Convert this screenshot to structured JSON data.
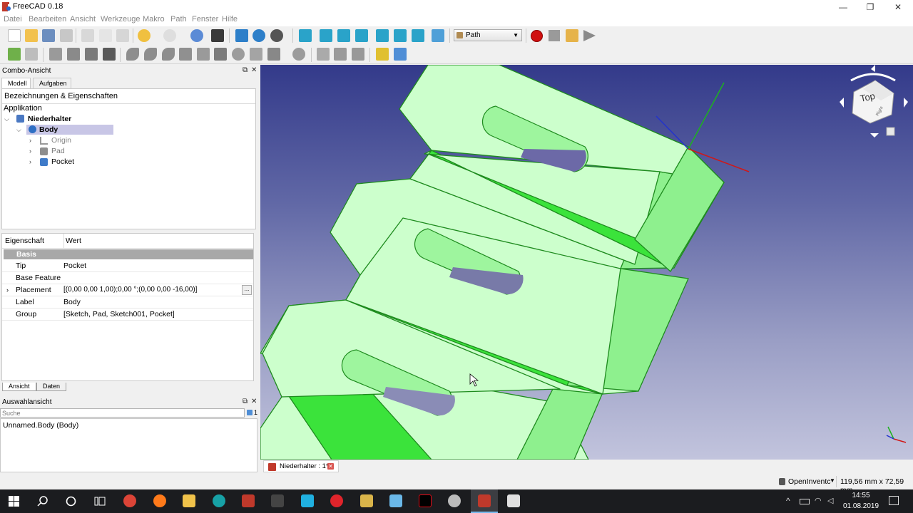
{
  "window": {
    "title": "FreeCAD 0.18",
    "controls": {
      "minimize": "—",
      "maximize": "❐",
      "close": "✕"
    }
  },
  "menu": [
    "Datei",
    "Bearbeiten",
    "Ansicht",
    "Werkzeuge",
    "Makro",
    "Path",
    "Fenster",
    "Hilfe"
  ],
  "toolbar": {
    "workbench_select": "Path"
  },
  "combo_view": {
    "title": "Combo-Ansicht",
    "tabs": [
      "Modell",
      "Aufgaben"
    ],
    "tree_header": "Bezeichnungen & Eigenschaften",
    "tree_section": "Applikation",
    "tree": {
      "document": "Niederhalter",
      "body": "Body",
      "children": [
        "Origin",
        "Pad",
        "Pocket"
      ]
    },
    "properties": {
      "col_property": "Eigenschaft",
      "col_value": "Wert",
      "group": "Basis",
      "rows": [
        {
          "key": "Tip",
          "value": "Pocket"
        },
        {
          "key": "Base Feature",
          "value": ""
        },
        {
          "key": "Placement",
          "value": "[(0,00 0,00 1,00);0,00 °;(0,00 0,00 -16,00)]"
        },
        {
          "key": "Label",
          "value": "Body"
        },
        {
          "key": "Group",
          "value": "[Sketch, Pad, Sketch001, Pocket]"
        }
      ],
      "dots": "..."
    },
    "bottom_tabs": [
      "Ansicht",
      "Daten"
    ]
  },
  "selection_view": {
    "title": "Auswahlansicht",
    "search_placeholder": "Suche",
    "count": "1",
    "items": [
      "Unnamed.Body (Body)"
    ]
  },
  "viewport": {
    "navcube_label": "Top",
    "navcube_side": "Right",
    "colors": {
      "part_face": "#ccffcc",
      "part_side": "#8ef08e",
      "part_slant": "#3be33b",
      "edge": "#1e8b1e"
    }
  },
  "document_tab": {
    "label": "Niederhalter : 1*"
  },
  "status_bar": {
    "navigation_style": "OpenInventc",
    "dimensions": "119,56 mm x 72,59 mm"
  },
  "taskbar": {
    "time": "14:55",
    "date": "01.08.2019"
  }
}
